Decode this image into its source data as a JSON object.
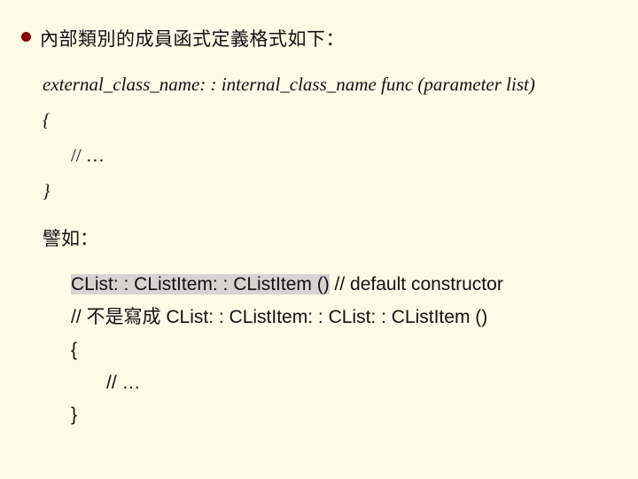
{
  "bullet": {
    "text": "內部類別的成員函式定義格式如下："
  },
  "syntax": {
    "line": "external_class_name: : internal_class_name func (parameter list)",
    "open_brace": "{",
    "comment": "// …",
    "close_brace": "}"
  },
  "example_label": "譬如：",
  "code": {
    "line1_a": "CList: : CListItem: : CListItem ()",
    "line1_b": " // default constructor",
    "line2_a": "// ",
    "line2_b": "不是寫成 ",
    "line2_c": "CList: : CListItem: : CList: : CListItem ()",
    "open_brace": "{",
    "inner_comment": "// …",
    "close_brace": "}"
  }
}
